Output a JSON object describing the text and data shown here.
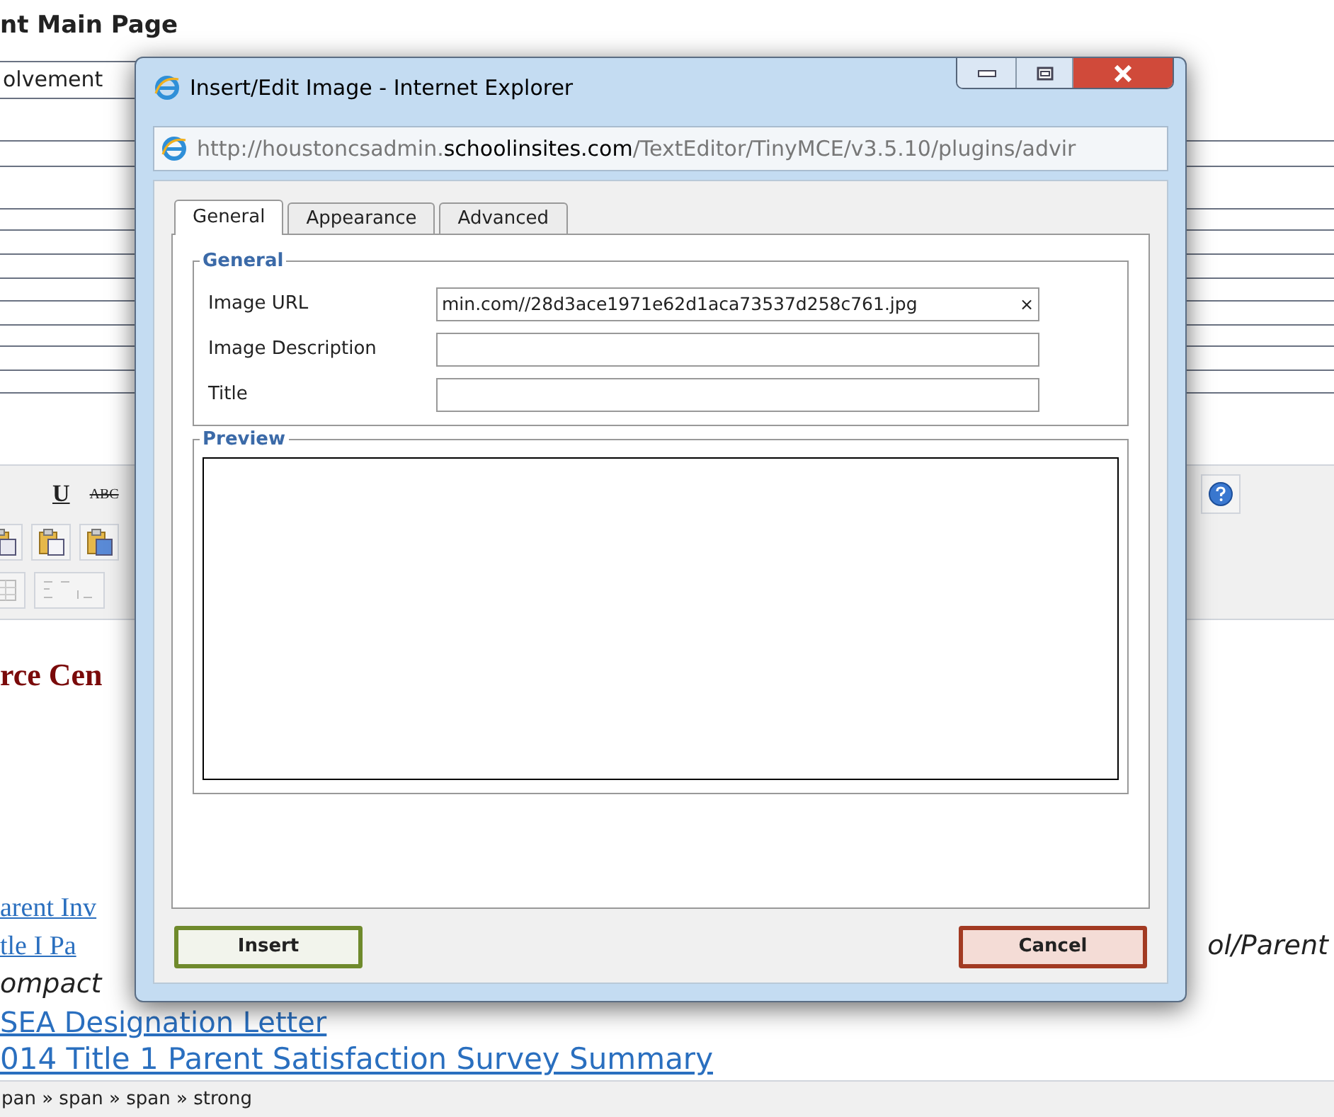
{
  "page": {
    "heading": "nt Main Page",
    "field_value": "olvement",
    "toolbar": {
      "buttons": [
        {
          "label": "U",
          "kind": "underline"
        },
        {
          "label": "ABC",
          "kind": "strike"
        }
      ]
    },
    "section_heading": "rce Cen",
    "lines": [
      {
        "text": "arent Inv",
        "kind": "seriflink"
      },
      {
        "text": "tle I Pa",
        "kind": "seriflink",
        "side_text": "ol/Parent"
      },
      {
        "text": "ompact",
        "kind": "italic"
      },
      {
        "text": "SEA Designation Letter",
        "kind": "link"
      },
      {
        "text": "014 Title 1 Parent Satisfaction Survey Summary",
        "kind": "biglink"
      }
    ],
    "status_bar": "pan » span » span » strong"
  },
  "dialog": {
    "title": "Insert/Edit Image - Internet Explorer",
    "address": "http://houstoncsadmin.**schoolinsites.com**/TextEditor/TinyMCE/v3.5.10/plugins/advir",
    "tabs": [
      {
        "label": "General",
        "selected": true
      },
      {
        "label": "Appearance",
        "selected": false
      },
      {
        "label": "Advanced",
        "selected": false
      }
    ],
    "general": {
      "legend": "General",
      "fields": [
        {
          "label": "Image URL",
          "value": "min.com//28d3ace1971e62d1aca73537d258c761.jpg",
          "clear": "×"
        },
        {
          "label": "Image Description"
        },
        {
          "label": "Title"
        }
      ]
    },
    "preview": {
      "legend": "Preview"
    },
    "buttons": [
      {
        "label": "Insert",
        "kind": "insert"
      },
      {
        "label": "Cancel",
        "kind": "cancel"
      }
    ]
  }
}
